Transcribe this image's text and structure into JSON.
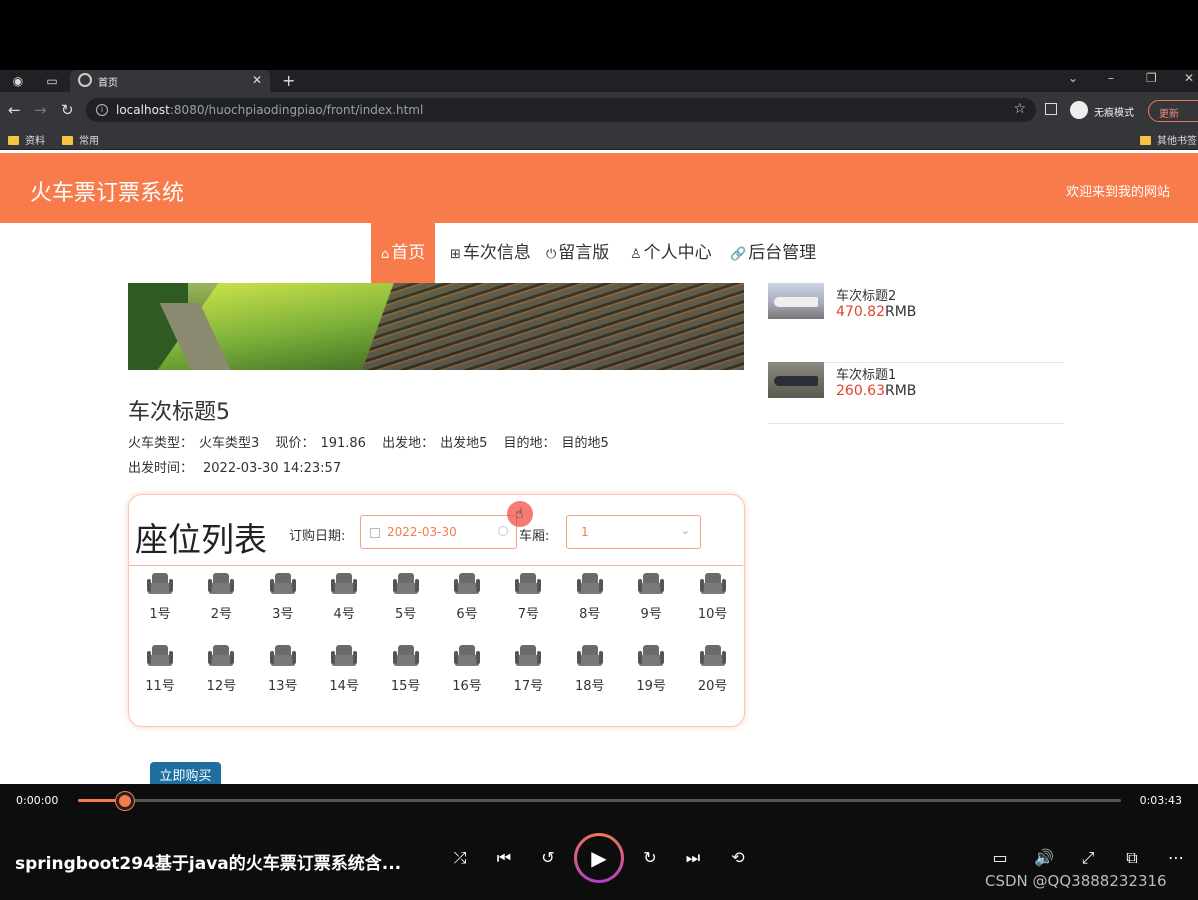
{
  "browser": {
    "tab_title": "首页",
    "url_host": "localhost",
    "url_rest": ":8080/huochpiaodingpiao/front/index.html",
    "incognito_label": "无痕模式",
    "update_label": "更新",
    "bookmarks": [
      "资料",
      "常用"
    ],
    "other_bookmarks": "其他书签"
  },
  "site": {
    "title": "火车票订票系统",
    "welcome": "欢迎来到我的网站",
    "nav": [
      {
        "icon": "⌂",
        "label": "首页"
      },
      {
        "icon": "⊞",
        "label": "车次信息"
      },
      {
        "icon": "⏻",
        "label": "留言版"
      },
      {
        "icon": "♙",
        "label": "个人中心"
      },
      {
        "icon": "🔗",
        "label": "后台管理"
      }
    ]
  },
  "detail": {
    "title": "车次标题5",
    "meta": [
      {
        "key": "火车类型：",
        "value": "火车类型3"
      },
      {
        "key": "现价：",
        "value": "191.86"
      },
      {
        "key": "出发地：",
        "value": "出发地5"
      },
      {
        "key": "目的地：",
        "value": "目的地5"
      }
    ],
    "depart_key": "出发时间：",
    "depart_value": "2022-03-30 14:23:57"
  },
  "seating": {
    "heading": "座位列表",
    "date_label": "订购日期:",
    "date_value": "2022-03-30",
    "car_label": "车厢:",
    "car_value": "1",
    "seats": [
      "1号",
      "2号",
      "3号",
      "4号",
      "5号",
      "6号",
      "7号",
      "8号",
      "9号",
      "10号",
      "11号",
      "12号",
      "13号",
      "14号",
      "15号",
      "16号",
      "17号",
      "18号",
      "19号",
      "20号"
    ]
  },
  "buy_label": "立即购买",
  "side": [
    {
      "name": "车次标题2",
      "price": "470.82",
      "unit": "RMB"
    },
    {
      "name": "车次标题1",
      "price": "260.63",
      "unit": "RMB"
    }
  ],
  "player": {
    "current": "0:00:00",
    "total": "0:03:43",
    "progress_fraction": 0.045,
    "title": "springboot294基于java的火车票订票系统含...",
    "watermark": "CSDN @QQ3888232316",
    "accent": "#f77b4b"
  }
}
